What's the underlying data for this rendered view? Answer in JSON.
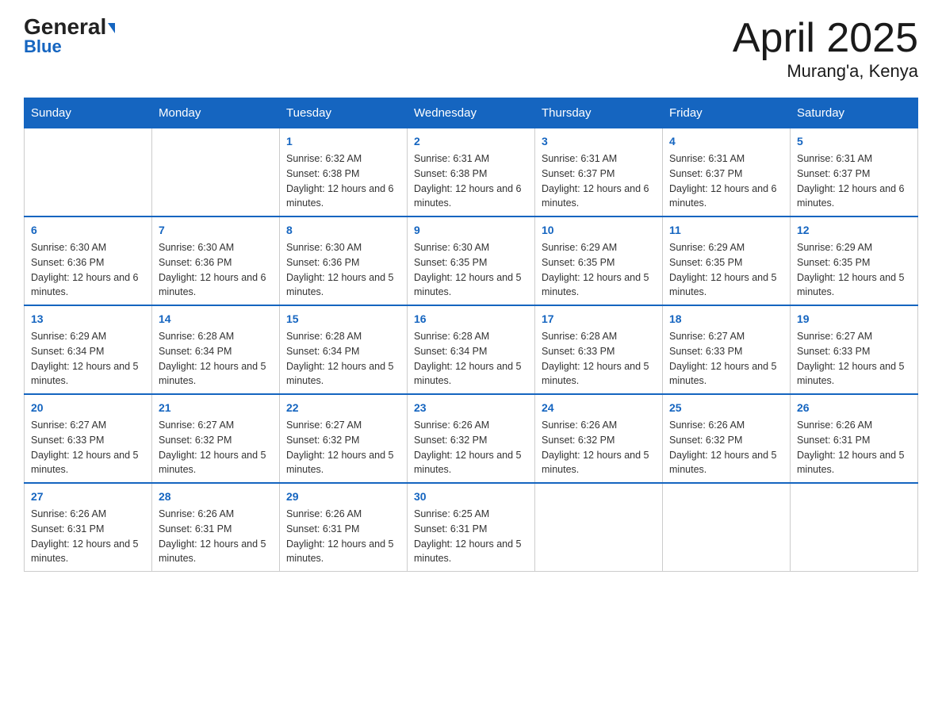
{
  "logo": {
    "general": "General",
    "arrow": "▶",
    "blue": "Blue"
  },
  "title": "April 2025",
  "subtitle": "Murang'a, Kenya",
  "days": [
    "Sunday",
    "Monday",
    "Tuesday",
    "Wednesday",
    "Thursday",
    "Friday",
    "Saturday"
  ],
  "weeks": [
    [
      {
        "day": "",
        "sunrise": "",
        "sunset": "",
        "daylight": ""
      },
      {
        "day": "",
        "sunrise": "",
        "sunset": "",
        "daylight": ""
      },
      {
        "day": "1",
        "sunrise": "Sunrise: 6:32 AM",
        "sunset": "Sunset: 6:38 PM",
        "daylight": "Daylight: 12 hours and 6 minutes."
      },
      {
        "day": "2",
        "sunrise": "Sunrise: 6:31 AM",
        "sunset": "Sunset: 6:38 PM",
        "daylight": "Daylight: 12 hours and 6 minutes."
      },
      {
        "day": "3",
        "sunrise": "Sunrise: 6:31 AM",
        "sunset": "Sunset: 6:37 PM",
        "daylight": "Daylight: 12 hours and 6 minutes."
      },
      {
        "day": "4",
        "sunrise": "Sunrise: 6:31 AM",
        "sunset": "Sunset: 6:37 PM",
        "daylight": "Daylight: 12 hours and 6 minutes."
      },
      {
        "day": "5",
        "sunrise": "Sunrise: 6:31 AM",
        "sunset": "Sunset: 6:37 PM",
        "daylight": "Daylight: 12 hours and 6 minutes."
      }
    ],
    [
      {
        "day": "6",
        "sunrise": "Sunrise: 6:30 AM",
        "sunset": "Sunset: 6:36 PM",
        "daylight": "Daylight: 12 hours and 6 minutes."
      },
      {
        "day": "7",
        "sunrise": "Sunrise: 6:30 AM",
        "sunset": "Sunset: 6:36 PM",
        "daylight": "Daylight: 12 hours and 6 minutes."
      },
      {
        "day": "8",
        "sunrise": "Sunrise: 6:30 AM",
        "sunset": "Sunset: 6:36 PM",
        "daylight": "Daylight: 12 hours and 5 minutes."
      },
      {
        "day": "9",
        "sunrise": "Sunrise: 6:30 AM",
        "sunset": "Sunset: 6:35 PM",
        "daylight": "Daylight: 12 hours and 5 minutes."
      },
      {
        "day": "10",
        "sunrise": "Sunrise: 6:29 AM",
        "sunset": "Sunset: 6:35 PM",
        "daylight": "Daylight: 12 hours and 5 minutes."
      },
      {
        "day": "11",
        "sunrise": "Sunrise: 6:29 AM",
        "sunset": "Sunset: 6:35 PM",
        "daylight": "Daylight: 12 hours and 5 minutes."
      },
      {
        "day": "12",
        "sunrise": "Sunrise: 6:29 AM",
        "sunset": "Sunset: 6:35 PM",
        "daylight": "Daylight: 12 hours and 5 minutes."
      }
    ],
    [
      {
        "day": "13",
        "sunrise": "Sunrise: 6:29 AM",
        "sunset": "Sunset: 6:34 PM",
        "daylight": "Daylight: 12 hours and 5 minutes."
      },
      {
        "day": "14",
        "sunrise": "Sunrise: 6:28 AM",
        "sunset": "Sunset: 6:34 PM",
        "daylight": "Daylight: 12 hours and 5 minutes."
      },
      {
        "day": "15",
        "sunrise": "Sunrise: 6:28 AM",
        "sunset": "Sunset: 6:34 PM",
        "daylight": "Daylight: 12 hours and 5 minutes."
      },
      {
        "day": "16",
        "sunrise": "Sunrise: 6:28 AM",
        "sunset": "Sunset: 6:34 PM",
        "daylight": "Daylight: 12 hours and 5 minutes."
      },
      {
        "day": "17",
        "sunrise": "Sunrise: 6:28 AM",
        "sunset": "Sunset: 6:33 PM",
        "daylight": "Daylight: 12 hours and 5 minutes."
      },
      {
        "day": "18",
        "sunrise": "Sunrise: 6:27 AM",
        "sunset": "Sunset: 6:33 PM",
        "daylight": "Daylight: 12 hours and 5 minutes."
      },
      {
        "day": "19",
        "sunrise": "Sunrise: 6:27 AM",
        "sunset": "Sunset: 6:33 PM",
        "daylight": "Daylight: 12 hours and 5 minutes."
      }
    ],
    [
      {
        "day": "20",
        "sunrise": "Sunrise: 6:27 AM",
        "sunset": "Sunset: 6:33 PM",
        "daylight": "Daylight: 12 hours and 5 minutes."
      },
      {
        "day": "21",
        "sunrise": "Sunrise: 6:27 AM",
        "sunset": "Sunset: 6:32 PM",
        "daylight": "Daylight: 12 hours and 5 minutes."
      },
      {
        "day": "22",
        "sunrise": "Sunrise: 6:27 AM",
        "sunset": "Sunset: 6:32 PM",
        "daylight": "Daylight: 12 hours and 5 minutes."
      },
      {
        "day": "23",
        "sunrise": "Sunrise: 6:26 AM",
        "sunset": "Sunset: 6:32 PM",
        "daylight": "Daylight: 12 hours and 5 minutes."
      },
      {
        "day": "24",
        "sunrise": "Sunrise: 6:26 AM",
        "sunset": "Sunset: 6:32 PM",
        "daylight": "Daylight: 12 hours and 5 minutes."
      },
      {
        "day": "25",
        "sunrise": "Sunrise: 6:26 AM",
        "sunset": "Sunset: 6:32 PM",
        "daylight": "Daylight: 12 hours and 5 minutes."
      },
      {
        "day": "26",
        "sunrise": "Sunrise: 6:26 AM",
        "sunset": "Sunset: 6:31 PM",
        "daylight": "Daylight: 12 hours and 5 minutes."
      }
    ],
    [
      {
        "day": "27",
        "sunrise": "Sunrise: 6:26 AM",
        "sunset": "Sunset: 6:31 PM",
        "daylight": "Daylight: 12 hours and 5 minutes."
      },
      {
        "day": "28",
        "sunrise": "Sunrise: 6:26 AM",
        "sunset": "Sunset: 6:31 PM",
        "daylight": "Daylight: 12 hours and 5 minutes."
      },
      {
        "day": "29",
        "sunrise": "Sunrise: 6:26 AM",
        "sunset": "Sunset: 6:31 PM",
        "daylight": "Daylight: 12 hours and 5 minutes."
      },
      {
        "day": "30",
        "sunrise": "Sunrise: 6:25 AM",
        "sunset": "Sunset: 6:31 PM",
        "daylight": "Daylight: 12 hours and 5 minutes."
      },
      {
        "day": "",
        "sunrise": "",
        "sunset": "",
        "daylight": ""
      },
      {
        "day": "",
        "sunrise": "",
        "sunset": "",
        "daylight": ""
      },
      {
        "day": "",
        "sunrise": "",
        "sunset": "",
        "daylight": ""
      }
    ]
  ]
}
